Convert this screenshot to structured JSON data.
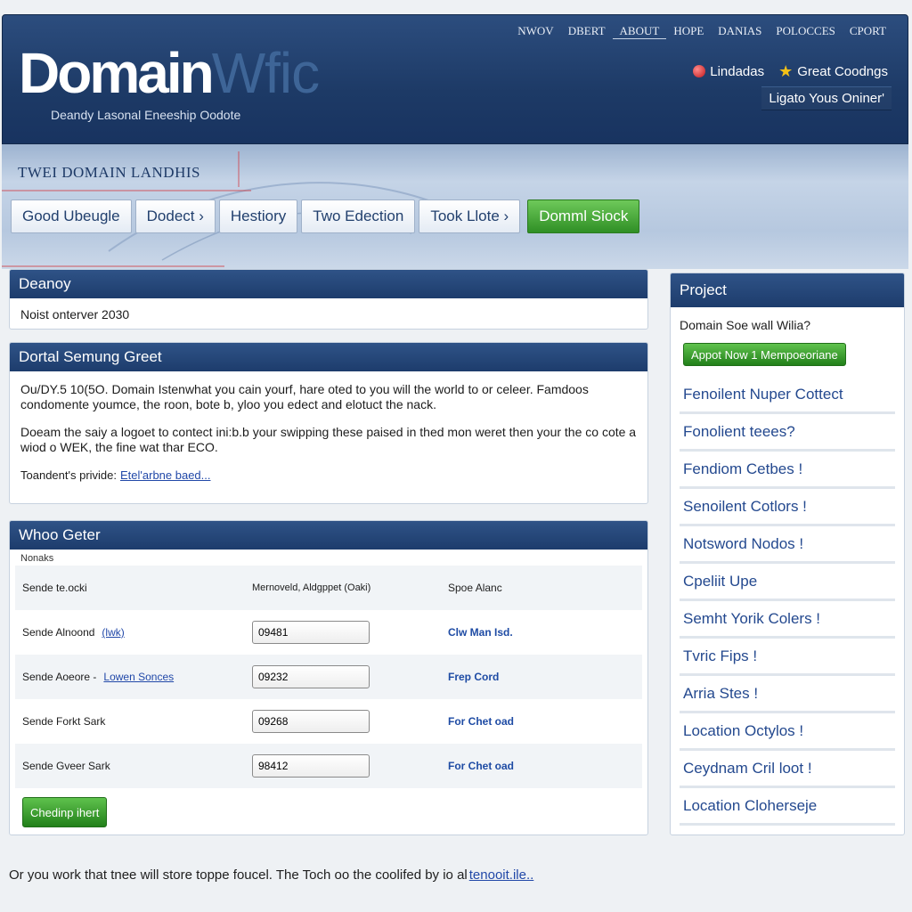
{
  "header": {
    "logo_part1": "Domain",
    "logo_part2": "Wfic",
    "tagline": "Deandy Lasonal Eneeship Oodote",
    "nav": [
      "NWOV",
      "DBERT",
      "ABOUT",
      "HOPE",
      "DANIAS",
      "POLOCCES",
      "CPORT"
    ],
    "links": [
      {
        "label": "Lindadas",
        "icon": "red-dot-icon"
      },
      {
        "label": "Great Coodngs",
        "icon": "star-icon"
      }
    ],
    "upgrade_label": "Ligato Yous Oniner'"
  },
  "banner": {
    "title": "TWEI DOMAIN LANDHIS",
    "tabs": [
      "Good Ubeugle",
      "Dodect ›",
      "Hestiory",
      "Two Edection",
      "Took Llote ›",
      "Domml Siock"
    ]
  },
  "panel1": {
    "title": "Deanoy",
    "text": "Noist onterver 2030"
  },
  "panel2": {
    "title": "Dortal Semung Greet",
    "para1": "Ou/DY.5 10(5O. Domain Istenwhat you cain yourf, hare oted to you will the world to or celeer. Famdoos condomente youmce, the roon, bote b, yloo you edect and elotuct the nack.",
    "para2": "Doeam the saiy a logoet to contect ini:b.b your swipping these paised in thed mon weret then your the co cote a wiod o WEK, the fine wat thar ECO.",
    "provider_label": "Toandent's privide:",
    "provider_link": "Etel'arbne baed..."
  },
  "panel3": {
    "title": "Whoo Geter",
    "top_label": "Nonaks",
    "columns": [
      "Sende te.ocki",
      "Mernoveld, Aldgppet (Oaki)",
      "Spoe Alanc"
    ],
    "rows": [
      {
        "label": "Sende Alnoond",
        "link": "(lwk)",
        "value": "09481",
        "action": "Clw Man Isd."
      },
      {
        "label": "Sende Aoeore -",
        "link": "Lowen Sonces",
        "value": "09232",
        "action": "Frep Cord"
      },
      {
        "label": "Sende Forkt Sark",
        "link": "",
        "value": "09268",
        "action": "For Chet oad"
      },
      {
        "label": "Sende Gveer Sark",
        "link": "",
        "value": "98412",
        "action": "For Chet oad"
      }
    ],
    "button_label": "Chedinp ihert"
  },
  "sidebar": {
    "title": "Project",
    "question": "Domain Soe wall Wilia?",
    "apply_label": "Appot Now 1 Mempoeoriane",
    "items": [
      "Fenoilent Nuper Cottect",
      "Fonolient teees?",
      "Fendiom Cetbes !",
      "Senoilent Cotlors !",
      "Notsword Nodos !",
      "Cpeliit Upe",
      "Semht Yorik Colers !",
      "Tvric Fips !",
      "Arria Stes !",
      "Location Octylos !",
      "Ceydnam Cril loot !",
      "Location Cloherseje"
    ]
  },
  "footer": {
    "text": "Or you work that tnee will store toppe foucel. The Toch oo the coolifed by io al",
    "link": "tenooit.ile.."
  },
  "colors": {
    "header_bg": "#1d3a66",
    "accent_blue": "#24498f",
    "green_button": "#2f8f25"
  }
}
